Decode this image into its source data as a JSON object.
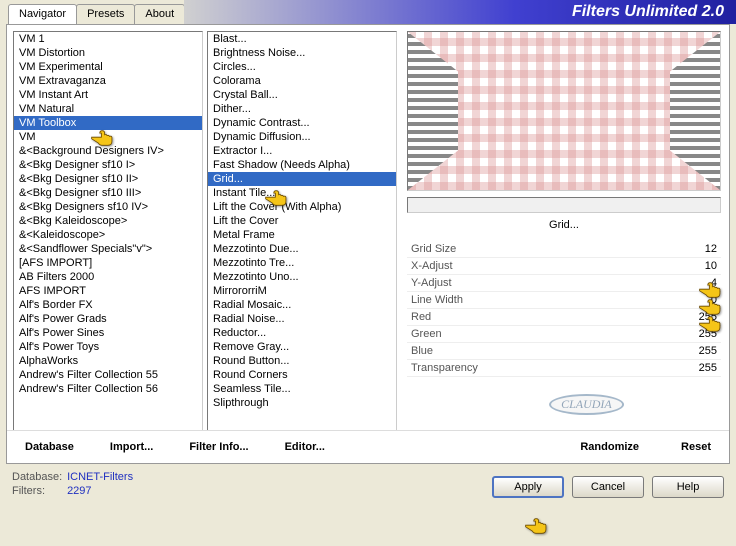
{
  "title": "Filters Unlimited 2.0",
  "tabs": [
    "Navigator",
    "Presets",
    "About"
  ],
  "active_tab": 0,
  "categories": [
    "VM 1",
    "VM Distortion",
    "VM Experimental",
    "VM Extravaganza",
    "VM Instant Art",
    "VM Natural",
    "VM Toolbox",
    "VM",
    "&<Background Designers IV>",
    "&<Bkg Designer sf10 I>",
    "&<Bkg Designer sf10 II>",
    "&<Bkg Designer sf10 III>",
    "&<Bkg Designers sf10 IV>",
    "&<Bkg Kaleidoscope>",
    "&<Kaleidoscope>",
    "&<Sandflower Specials\"v\">",
    "[AFS IMPORT]",
    "AB Filters 2000",
    "AFS IMPORT",
    "Alf's Border FX",
    "Alf's Power Grads",
    "Alf's Power Sines",
    "Alf's Power Toys",
    "AlphaWorks",
    "Andrew's Filter Collection 55",
    "Andrew's Filter Collection 56"
  ],
  "selected_category_idx": 6,
  "filters": [
    "Blast...",
    "Brightness Noise...",
    "Circles...",
    "Colorama",
    "Crystal Ball...",
    "Dither...",
    "Dynamic Contrast...",
    "Dynamic Diffusion...",
    "Extractor I...",
    "Fast Shadow (Needs Alpha)",
    "Grid...",
    "Instant Tile...",
    "Lift the Cover (With Alpha)",
    "Lift the Cover",
    "Metal Frame",
    "Mezzotinto Due...",
    "Mezzotinto Tre...",
    "Mezzotinto Uno...",
    "MirrororriM",
    "Radial Mosaic...",
    "Radial Noise...",
    "Reductor...",
    "Remove Gray...",
    "Round Button...",
    "Round Corners",
    "Seamless Tile...",
    "Slipthrough"
  ],
  "selected_filter_idx": 10,
  "current_filter": "Grid...",
  "params": [
    {
      "label": "Grid Size",
      "value": 12
    },
    {
      "label": "X-Adjust",
      "value": 10
    },
    {
      "label": "Y-Adjust",
      "value": 4
    },
    {
      "label": "Line Width",
      "value": 0
    },
    {
      "label": "Red",
      "value": 255
    },
    {
      "label": "Green",
      "value": 255
    },
    {
      "label": "Blue",
      "value": 255
    },
    {
      "label": "Transparency",
      "value": 255
    }
  ],
  "toolbar": {
    "database": "Database",
    "import": "Import...",
    "filter_info": "Filter Info...",
    "editor": "Editor...",
    "randomize": "Randomize",
    "reset": "Reset"
  },
  "footer": {
    "db_label": "Database:",
    "db_value": "ICNET-Filters",
    "filters_label": "Filters:",
    "filters_value": "2297"
  },
  "buttons": {
    "apply": "Apply",
    "cancel": "Cancel",
    "help": "Help"
  },
  "watermark": "CLAUDIA"
}
